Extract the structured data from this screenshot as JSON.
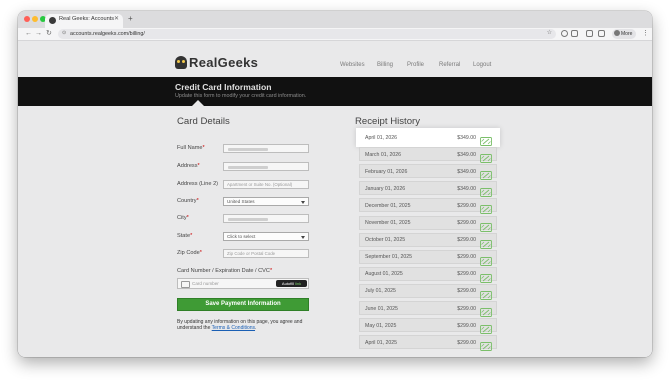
{
  "browser": {
    "tab_title": "Real Geeks: Accounts",
    "url": "accounts.realgeeks.com/billing/",
    "more_label": "More"
  },
  "header": {
    "logo_text": "RealGeeks",
    "nav": [
      "Websites",
      "Billing",
      "Profile",
      "Referral",
      "Logout"
    ]
  },
  "banner": {
    "title": "Credit Card Information",
    "subtitle": "Update this form to modify your credit card information."
  },
  "card_details": {
    "heading": "Card Details",
    "labels": {
      "full_name": "Full Name",
      "address": "Address",
      "address2": "Address (Line 2)",
      "country": "Country",
      "city": "City",
      "state": "State",
      "zip": "Zip Code",
      "card": "Card Number / Expiration Date / CVC"
    },
    "address2_placeholder": "Apartment or Suite No. (Optional)",
    "country_value": "United States",
    "state_value": "Click to select",
    "zip_placeholder": "Zip Code or Postal Code",
    "card_placeholder": "Card number",
    "autofill_label": "Autofill",
    "autofill_link": "link",
    "save_label": "Save Payment Information",
    "disclaimer_text": "By updating any information on this page, you agree and understand the",
    "terms_link": "Terms & Conditions"
  },
  "receipts": {
    "heading": "Receipt History",
    "items": [
      {
        "date": "April 01, 2026",
        "amount": "$349.00"
      },
      {
        "date": "March 01, 2026",
        "amount": "$349.00"
      },
      {
        "date": "February 01, 2026",
        "amount": "$349.00"
      },
      {
        "date": "January 01, 2026",
        "amount": "$349.00"
      },
      {
        "date": "December 01, 2025",
        "amount": "$299.00"
      },
      {
        "date": "November 01, 2025",
        "amount": "$299.00"
      },
      {
        "date": "October 01, 2025",
        "amount": "$299.00"
      },
      {
        "date": "September 01, 2025",
        "amount": "$299.00"
      },
      {
        "date": "August 01, 2025",
        "amount": "$299.00"
      },
      {
        "date": "July 01, 2025",
        "amount": "$299.00"
      },
      {
        "date": "June 01, 2025",
        "amount": "$299.00"
      },
      {
        "date": "May 01, 2025",
        "amount": "$299.00"
      },
      {
        "date": "April 01, 2025",
        "amount": "$299.00"
      }
    ]
  },
  "colors": {
    "accent_green": "#3f9b35",
    "banner_bg": "#111111",
    "icon_green": "#7bbf6a"
  }
}
